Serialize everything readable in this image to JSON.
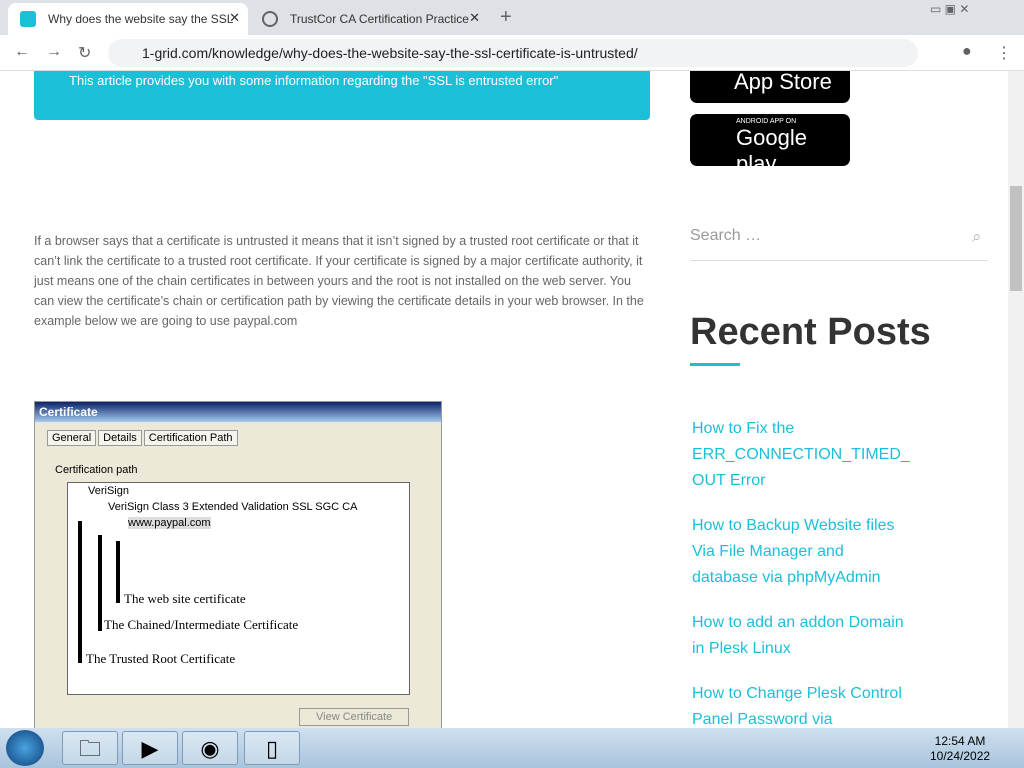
{
  "tabs": [
    {
      "title": "Why does the website say the SSL",
      "favicon_color": "#1cbfd8"
    },
    {
      "title": "TrustCor CA Certification Practice",
      "favicon_color": "#5f6368"
    }
  ],
  "url": "1-grid.com/knowledge/why-does-the-website-say-the-ssl-certificate-is-untrusted/",
  "banner": "This article provides you with some information regarding the \"SSL is entrusted error\"",
  "paragraph": "If a browser says that a certificate is untrusted it means that it isn’t signed by a trusted root certificate or that it can’t link the certificate to a trusted root certificate. If your certificate is signed by a major certificate authority, it just means one of the chain certificates in between yours and the root is not installed on the web server. You can view the certificate’s chain or certification path by viewing the certificate details in your web browser. In the example below we are going to use paypal.com",
  "cert": {
    "title": "Certificate",
    "tabs": [
      "General",
      "Details",
      "Certification Path"
    ],
    "group": "Certification path",
    "nodes": [
      "VeriSign",
      "VeriSign Class 3 Extended Validation SSL SGC CA",
      "www.paypal.com"
    ],
    "labels": [
      "The web site certificate",
      "The Chained/Intermediate Certificate",
      "The Trusted Root Certificate"
    ],
    "button": "View Certificate"
  },
  "store": {
    "apple": "App Store",
    "google": "Google play",
    "google_small": "ANDROID APP ON"
  },
  "search": {
    "placeholder": "Search …"
  },
  "recent_posts": {
    "heading": "Recent Posts",
    "posts": [
      "How to Fix the ERR_CONNECTION_TIMED_ OUT Error",
      "How to Backup Website files Via File Manager and database via phpMyAdmin",
      "How to add an addon Domain in Plesk Linux",
      "How to Change Plesk Control Panel Password via"
    ]
  },
  "clock": {
    "time": "12:54 AM",
    "date": "10/24/2022"
  }
}
